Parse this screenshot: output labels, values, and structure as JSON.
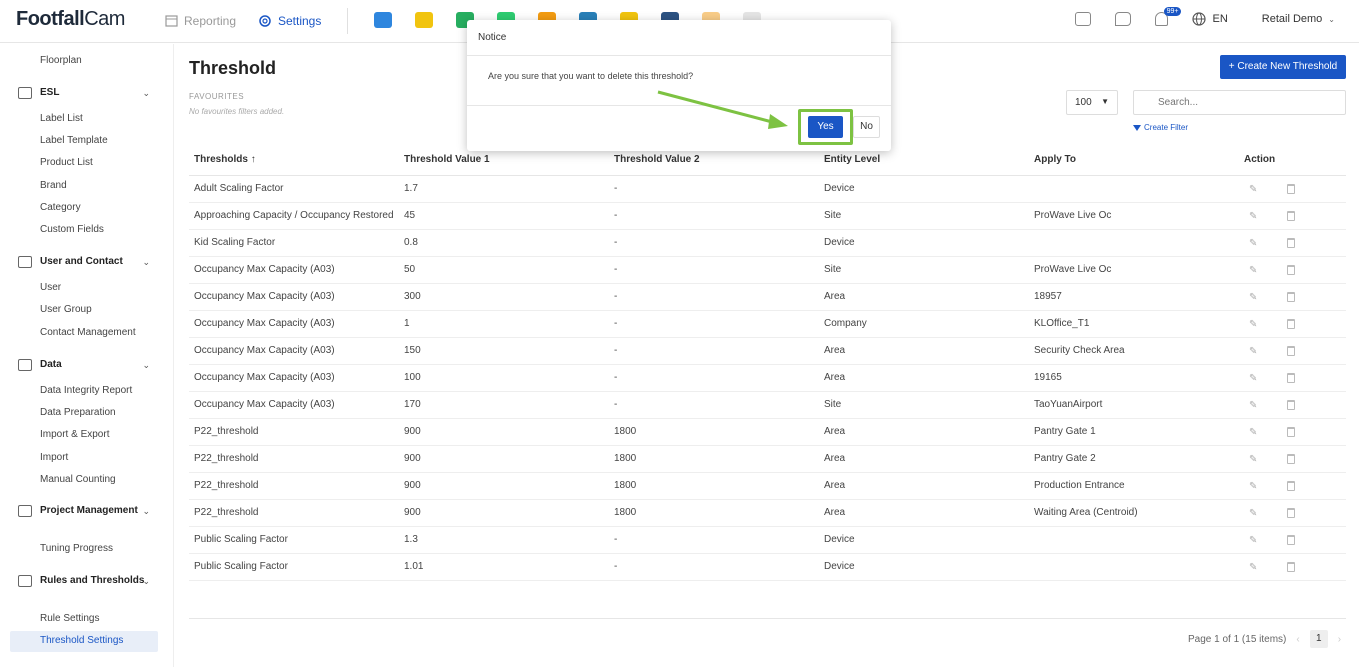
{
  "header": {
    "logo_main": "Footfall",
    "logo_cam": "Cam",
    "nav_reporting": "Reporting",
    "nav_settings": "Settings",
    "app_icon_colors": [
      "#2e86de",
      "#f1c40f",
      "#27ae60",
      "#2ecc71",
      "#f39c12",
      "#2980b9",
      "#f1c40f",
      "#2c5282",
      "#f39c12",
      "#cccccc"
    ],
    "notification_badge": "99+",
    "language": "EN",
    "user": "Retail Demo"
  },
  "sidebar": {
    "items_top": [
      {
        "label": "Floorplan"
      }
    ],
    "groups": [
      {
        "label": "ESL",
        "icon": "esl-icon",
        "items": [
          "Label List",
          "Label Template",
          "Product List",
          "Brand",
          "Category",
          "Custom Fields"
        ]
      },
      {
        "label": "User and Contact",
        "icon": "users-icon",
        "items": [
          "User",
          "User Group",
          "Contact Management"
        ]
      },
      {
        "label": "Data",
        "icon": "database-icon",
        "items": [
          "Data Integrity Report",
          "Data Preparation",
          "Import & Export",
          "Import",
          "Manual Counting"
        ]
      },
      {
        "label": "Project Management",
        "icon": "folder-settings-icon",
        "items": [
          "Tuning Progress"
        ]
      },
      {
        "label": "Rules and Thresholds",
        "icon": "sliders-icon",
        "items": [
          "Rule Settings",
          "Threshold Settings"
        ]
      }
    ],
    "active_item": "Threshold Settings"
  },
  "main": {
    "title": "Threshold",
    "favourites_title": "FAVOURITES",
    "favourites_empty": "No favourites filters added.",
    "create_button": "+ Create New Threshold",
    "page_size": "100",
    "search_placeholder": "Search...",
    "create_filter": "Create Filter",
    "columns": [
      "Thresholds",
      "Threshold Value 1",
      "Threshold Value 2",
      "Entity Level",
      "Apply To",
      "Action"
    ],
    "sort_indicator": "↑",
    "rows": [
      [
        "Adult Scaling Factor",
        "1.7",
        "-",
        "Device",
        ""
      ],
      [
        "Approaching Capacity / Occupancy Restored",
        "45",
        "-",
        "Site",
        "ProWave Live Oc"
      ],
      [
        "Kid Scaling Factor",
        "0.8",
        "-",
        "Device",
        ""
      ],
      [
        "Occupancy Max Capacity (A03)",
        "50",
        "-",
        "Site",
        "ProWave Live Oc"
      ],
      [
        "Occupancy Max Capacity (A03)",
        "300",
        "-",
        "Area",
        "18957"
      ],
      [
        "Occupancy Max Capacity (A03)",
        "1",
        "-",
        "Company",
        "KLOffice_T1"
      ],
      [
        "Occupancy Max Capacity (A03)",
        "150",
        "-",
        "Area",
        "Security Check Area"
      ],
      [
        "Occupancy Max Capacity (A03)",
        "100",
        "-",
        "Area",
        "19165"
      ],
      [
        "Occupancy Max Capacity (A03)",
        "170",
        "-",
        "Site",
        "TaoYuanAirport"
      ],
      [
        "P22_threshold",
        "900",
        "1800",
        "Area",
        "Pantry Gate 1"
      ],
      [
        "P22_threshold",
        "900",
        "1800",
        "Area",
        "Pantry Gate 2"
      ],
      [
        "P22_threshold",
        "900",
        "1800",
        "Area",
        "Production Entrance"
      ],
      [
        "P22_threshold",
        "900",
        "1800",
        "Area",
        "Waiting Area (Centroid)"
      ],
      [
        "Public Scaling Factor",
        "1.3",
        "-",
        "Device",
        ""
      ],
      [
        "Public Scaling Factor",
        "1.01",
        "-",
        "Device",
        ""
      ]
    ],
    "pager_text": "Page 1 of 1 (15 items)",
    "pager_page": "1"
  },
  "dialog": {
    "title": "Notice",
    "message": "Are you sure that you want to delete this threshold?",
    "yes": "Yes",
    "no": "No",
    "highlight_color": "#7dc242"
  }
}
